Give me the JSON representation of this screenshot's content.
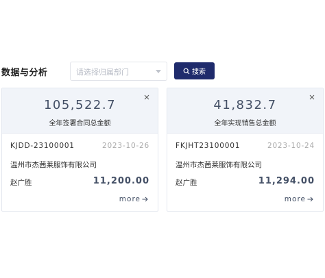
{
  "header": {
    "title": "数据与分析",
    "select_placeholder": "请选择归属部门",
    "search_label": "搜索"
  },
  "cards": [
    {
      "amount": "105,522.7",
      "label": "全年签署合同总金额",
      "code": "KJDD-23100001",
      "date": "2023-10-26",
      "company": "温州市杰茜莱服饰有限公司",
      "person": "赵广胜",
      "money": "11,200.00",
      "more": "more"
    },
    {
      "amount": "41,832.7",
      "label": "全年实现销售总金额",
      "code": "FKJHT23100001",
      "date": "2023-10-24",
      "company": "温州市杰茜莱服饰有限公司",
      "person": "赵广胜",
      "money": "11,294.00",
      "more": "more"
    }
  ],
  "colors": {
    "primary": "#1f2b6c",
    "card_header_bg": "#f1f4f9",
    "amount_text": "#445066"
  }
}
